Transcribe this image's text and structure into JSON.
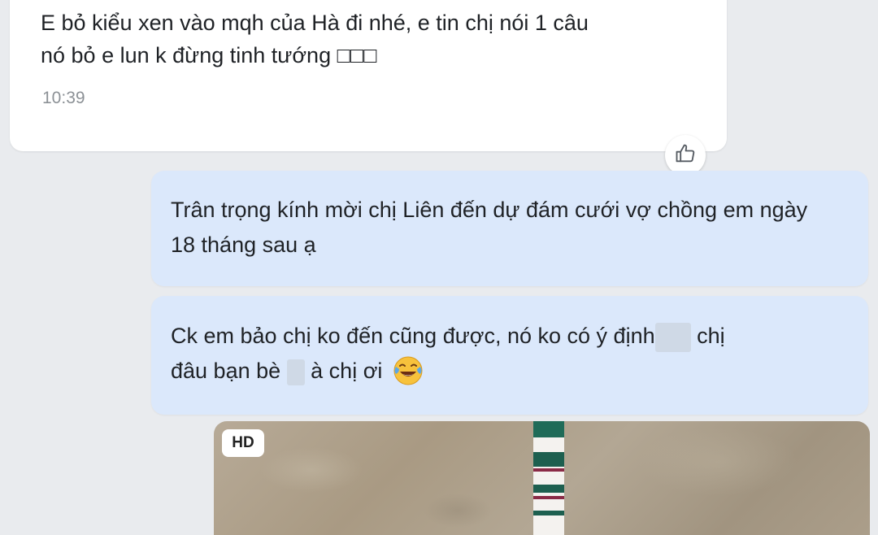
{
  "incoming": {
    "text": "E bỏ kiểu xen vào mqh của Hà đi nhé, e tin chị nói 1 câu\nnó bỏ e lun k đừng tinh tướng □□□",
    "time": "10:39"
  },
  "reaction": {
    "icon": "thumbs-up-icon"
  },
  "outgoing": [
    {
      "text": "Trân trọng kính mời chị Liên đến dự đám cưới vợ chồng em ngày 18 tháng sau ạ"
    },
    {
      "part1": "Ck em bảo chị ko đến cũng được, nó ko có ý định",
      "part2": " chị",
      "part3": "đâu bạn bè",
      "part4": " à chị ơi",
      "emoji": "laughing-tears-emoji"
    }
  ],
  "attachment": {
    "badge": "HD",
    "kind": "photo-test-strip"
  },
  "colors": {
    "background": "#e9ebee",
    "incoming_bubble": "#ffffff",
    "outgoing_bubble": "#dbe8fb"
  }
}
